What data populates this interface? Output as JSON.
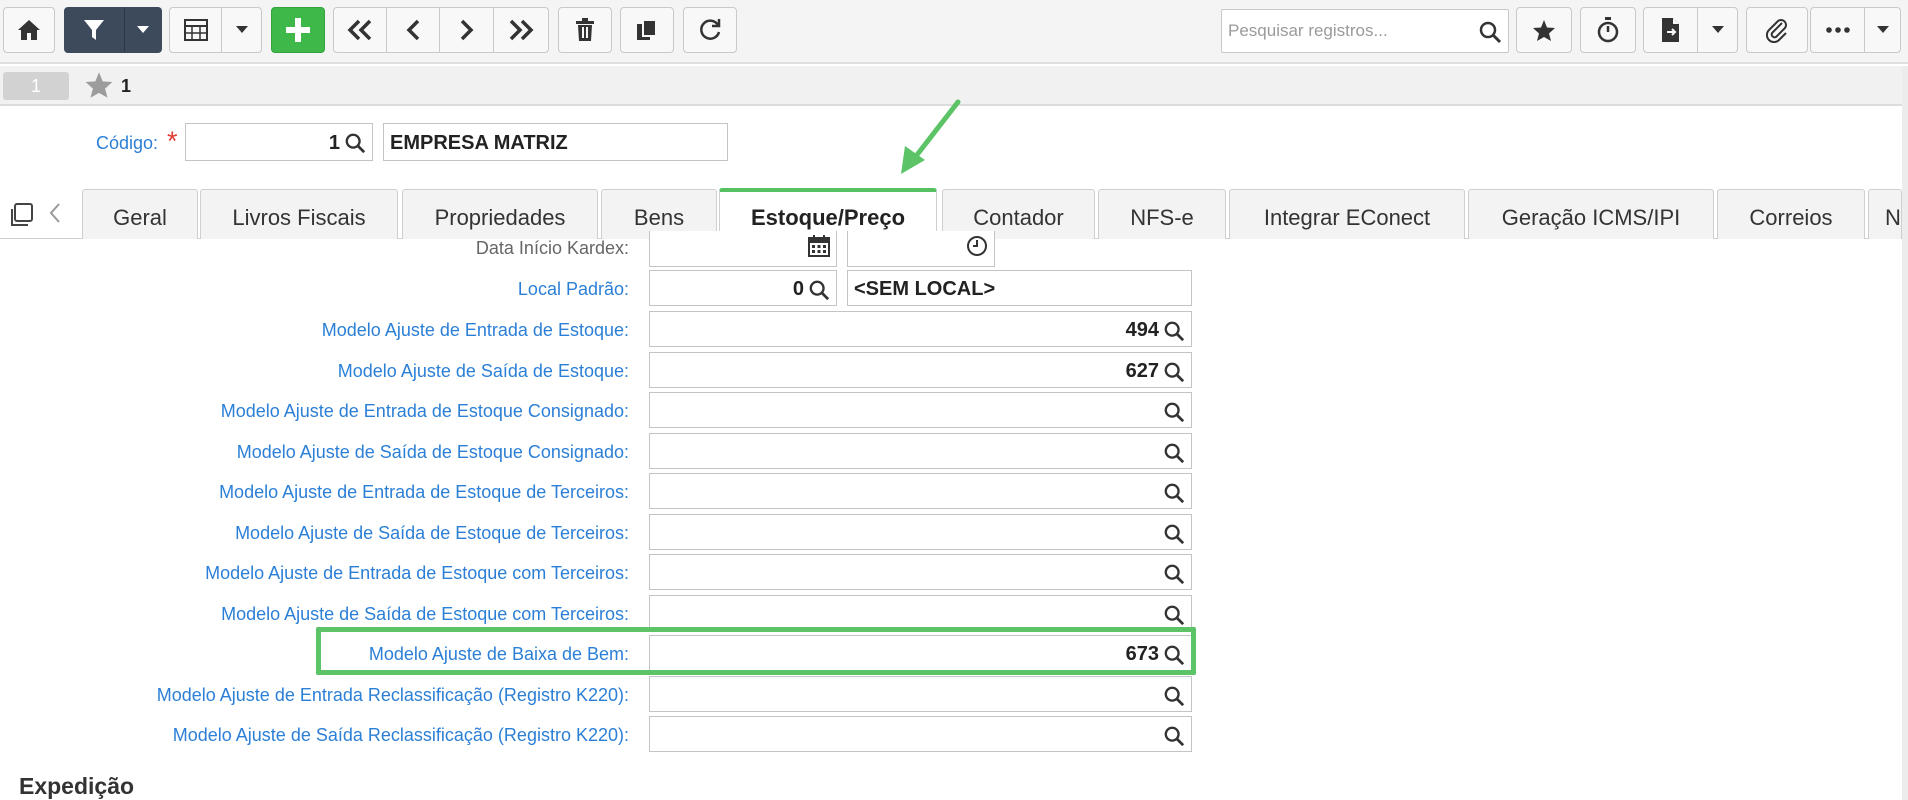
{
  "toolbar": {
    "search_placeholder": "Pesquisar registros..."
  },
  "record_bar": {
    "index": "1",
    "favorites_count": "1"
  },
  "header": {
    "code_label": "Código:",
    "required_mark": "*",
    "code_value": "1",
    "company_name": "EMPRESA MATRIZ"
  },
  "tabs": [
    {
      "label": "Geral"
    },
    {
      "label": "Livros Fiscais"
    },
    {
      "label": "Propriedades"
    },
    {
      "label": "Bens"
    },
    {
      "label": "Estoque/Preço",
      "active": true
    },
    {
      "label": "Contador"
    },
    {
      "label": "NFS-e"
    },
    {
      "label": "Integrar EConect"
    },
    {
      "label": "Geração ICMS/IPI"
    },
    {
      "label": "Correios"
    },
    {
      "label": "N"
    }
  ],
  "form": {
    "kardex_label": "Data Início Kardex:",
    "local_label": "Local Padrão:",
    "local_code": "0",
    "local_name": "<SEM LOCAL>",
    "rows": [
      {
        "label": "Modelo Ajuste de Entrada de Estoque:",
        "value": "494"
      },
      {
        "label": "Modelo Ajuste de Saída de Estoque:",
        "value": "627"
      },
      {
        "label": "Modelo Ajuste de Entrada de Estoque Consignado:",
        "value": ""
      },
      {
        "label": "Modelo Ajuste de Saída de Estoque Consignado:",
        "value": ""
      },
      {
        "label": "Modelo Ajuste de Entrada de Estoque de Terceiros:",
        "value": ""
      },
      {
        "label": "Modelo Ajuste de Saída de Estoque de Terceiros:",
        "value": ""
      },
      {
        "label": "Modelo Ajuste de Entrada de Estoque com Terceiros:",
        "value": ""
      },
      {
        "label": "Modelo Ajuste de Saída de Estoque com Terceiros:",
        "value": ""
      },
      {
        "label": "Modelo Ajuste de Baixa de Bem:",
        "value": "673"
      },
      {
        "label": "Modelo Ajuste de Entrada Reclassificação (Registro K220):",
        "value": ""
      },
      {
        "label": "Modelo Ajuste de Saída Reclassificação (Registro K220):",
        "value": ""
      }
    ]
  },
  "section": {
    "title": "Expedição"
  },
  "colors": {
    "label_blue": "#2b7fd7",
    "add_green": "#3fb84a",
    "filter_dark": "#3d4a5c",
    "highlight_green": "#5cc467",
    "required_red": "#e03c31"
  },
  "icons": [
    "home-icon",
    "filter-icon",
    "caret-down-icon",
    "grid-icon",
    "plus-icon",
    "first-icon",
    "prev-icon",
    "next-icon",
    "last-icon",
    "trash-icon",
    "copy-icon",
    "refresh-icon",
    "search-icon",
    "star-icon",
    "stopwatch-icon",
    "export-icon",
    "paperclip-icon",
    "more-icon",
    "calendar-icon",
    "clock-icon",
    "arrow-annotation-icon"
  ]
}
